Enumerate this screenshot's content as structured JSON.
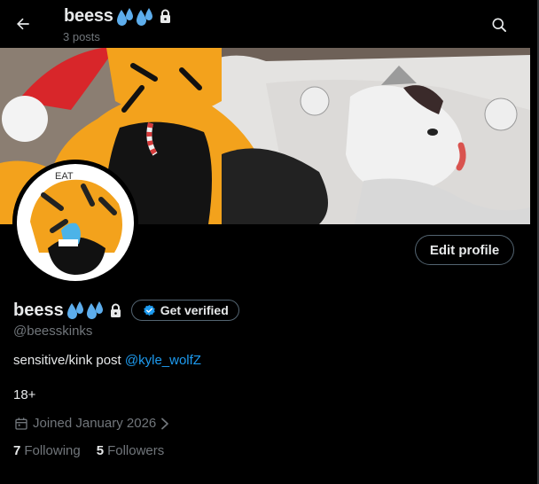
{
  "header": {
    "name": "beess",
    "posts": "3 posts",
    "back_icon": "arrow-left-icon",
    "search_icon": "search-icon"
  },
  "profile": {
    "display_name": "beess",
    "handle": "@beesskinks",
    "bio_text": "sensitive/kink post ",
    "bio_link": "@kyle_wolfZ",
    "bio_line2": "18+",
    "joined": "Joined January 2026",
    "protected_icon": "lock-icon",
    "emoji": "sweat-droplets-emoji"
  },
  "buttons": {
    "edit_profile": "Edit profile",
    "get_verified": "Get verified"
  },
  "stats": {
    "following_count": "7",
    "following_label": "Following",
    "followers_count": "5",
    "followers_label": "Followers"
  },
  "colors": {
    "background": "#000000",
    "text": "#e7e9ea",
    "muted": "#71767b",
    "link": "#1d9bf0",
    "border": "#536471"
  }
}
